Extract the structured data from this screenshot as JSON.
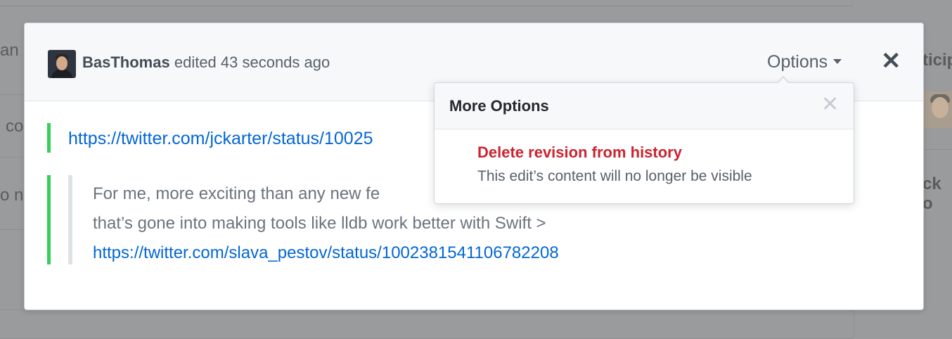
{
  "background": {
    "fragment_1": "an",
    "fragment_2": "co",
    "fragment_3": "o n",
    "fragment_4": "ticip",
    "fragment_5": "ck o"
  },
  "header": {
    "username": "BasThomas",
    "action_text": "edited 43 seconds ago",
    "options_label": "Options",
    "avatar_icon": "user-avatar",
    "close_icon": "close-icon"
  },
  "content": {
    "link": "https://twitter.com/jckarter/status/10025",
    "quote_line_1": "For me, more exciting than any new fe",
    "quote_line_2": "that’s gone into making tools like lldb work better with Swift >",
    "quote_link": "https://twitter.com/slava_pestov/status/1002381541106782208"
  },
  "dropdown": {
    "title": "More Options",
    "close_icon": "close-icon",
    "items": [
      {
        "title": "Delete revision from history",
        "description": "This edit’s content will no longer be visible"
      }
    ]
  },
  "colors": {
    "accent_link": "#0366d6",
    "danger": "#cb2431",
    "quote_marker": "#34d058"
  }
}
